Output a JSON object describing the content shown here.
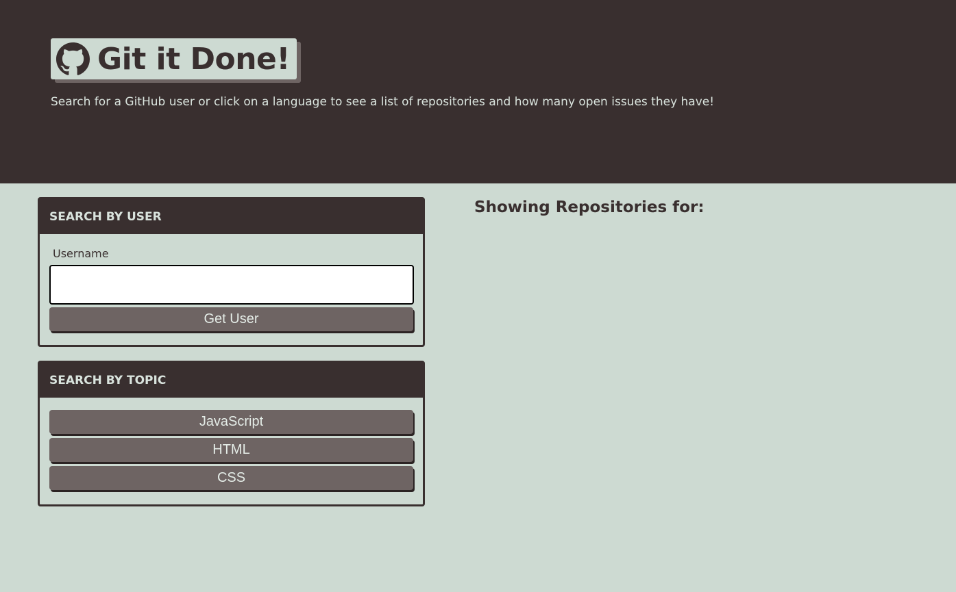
{
  "header": {
    "title": "Git it Done!",
    "logo_icon": "github-octocat-icon",
    "subtitle": "Search for a GitHub user or click on a language to see a list of repositories and how many open issues they have!"
  },
  "user_search": {
    "heading": "SEARCH BY USER",
    "username_label": "Username",
    "username_value": "",
    "button_label": "Get User"
  },
  "topic_search": {
    "heading": "SEARCH BY TOPIC",
    "languages": [
      "JavaScript",
      "HTML",
      "CSS"
    ]
  },
  "results": {
    "heading": "Showing Repositories for:"
  },
  "colors": {
    "dark": "#392f2f",
    "background": "#cddad2",
    "button": "#6e6463"
  }
}
